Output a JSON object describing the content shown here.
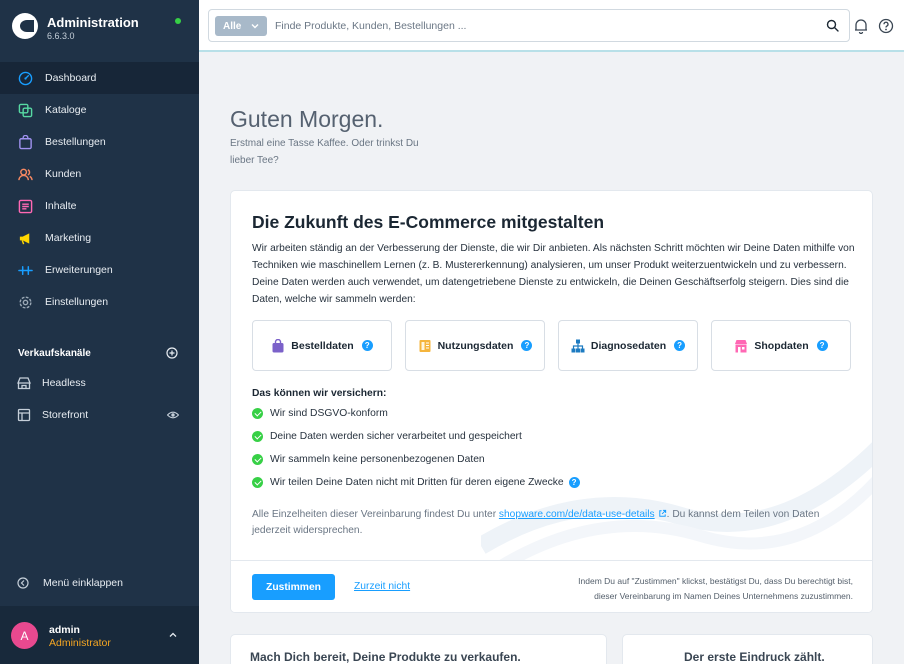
{
  "app": {
    "title": "Administration",
    "version": "6.6.3.0"
  },
  "sidebar": {
    "items": [
      {
        "label": "Dashboard",
        "icon": "dashboard-icon",
        "color": "#189eff"
      },
      {
        "label": "Kataloge",
        "icon": "catalog-icon",
        "color": "#57d9a3"
      },
      {
        "label": "Bestellungen",
        "icon": "orders-icon",
        "color": "#a092f0"
      },
      {
        "label": "Kunden",
        "icon": "customers-icon",
        "color": "#f88962"
      },
      {
        "label": "Inhalte",
        "icon": "content-icon",
        "color": "#ff68b4"
      },
      {
        "label": "Marketing",
        "icon": "marketing-icon",
        "color": "#ffd700"
      },
      {
        "label": "Erweiterungen",
        "icon": "extensions-icon",
        "color": "#189eff"
      },
      {
        "label": "Einstellungen",
        "icon": "settings-icon",
        "color": "#9aa8b5"
      }
    ],
    "sales_channels_title": "Verkaufskanäle",
    "channels": [
      {
        "label": "Headless",
        "icon": "headless-icon"
      },
      {
        "label": "Storefront",
        "icon": "storefront-icon"
      }
    ],
    "collapse_label": "Menü einklappen",
    "user": {
      "initial": "A",
      "name": "admin",
      "role": "Administrator"
    }
  },
  "search": {
    "type_label": "Alle",
    "placeholder": "Finde Produkte, Kunden, Bestellungen ..."
  },
  "greeting": {
    "title": "Guten Morgen.",
    "subtitle": "Erstmal eine Tasse Kaffee. Oder trinkst Du lieber Tee?"
  },
  "data_card": {
    "title": "Die Zukunft des E-Commerce mitgestalten",
    "text": "Wir arbeiten ständig an der Verbesserung der Dienste, die wir Dir anbieten. Als nächsten Schritt möchten wir Deine Daten mithilfe von Techniken wie maschinellem Lernen (z. B. Mustererkennung) analysieren, um unser Produkt weiterzuentwickeln und zu verbessern. Deine Daten werden auch verwendet, um datengetriebene Dienste zu entwickeln, die Deinen Geschäftserfolg steigern. Dies sind die Daten, welche wir sammeln werden:",
    "tiles": [
      {
        "label": "Bestelldaten",
        "icon": "shopping-bag-icon",
        "color": "#7b61c9"
      },
      {
        "label": "Nutzungsdaten",
        "icon": "document-icon",
        "color": "#f5b53d"
      },
      {
        "label": "Diagnosedaten",
        "icon": "hierarchy-icon",
        "color": "#1d7bc1"
      },
      {
        "label": "Shopdaten",
        "icon": "shop-icon",
        "color": "#ff68b4"
      }
    ],
    "assurance_title": "Das können wir versichern:",
    "assurances": [
      "Wir sind DSGVO-konform",
      "Deine Daten werden sicher verarbeitet und gespeichert",
      "Wir sammeln keine personenbezogenen Daten",
      "Wir teilen Deine Daten nicht mit Dritten für deren eigene Zwecke"
    ],
    "details_before": "Alle Einzelheiten dieser Vereinbarung findest Du unter ",
    "details_link": "shopware.com/de/data-use-details",
    "details_after": ". Du kannst dem Teilen von Daten jederzeit widersprechen.",
    "accept_label": "Zustimmen",
    "decline_label": "Zurzeit nicht",
    "footer_note": "Indem Du auf \"Zustimmen\" klickst, bestätigst Du, dass Du berechtigt bist, dieser Vereinbarung im Namen Deines Unternehmens zuzustimmen."
  },
  "bottom_cards": [
    {
      "title": "Mach Dich bereit, Deine Produkte zu verkaufen."
    },
    {
      "title": "Der erste Eindruck zählt."
    }
  ]
}
